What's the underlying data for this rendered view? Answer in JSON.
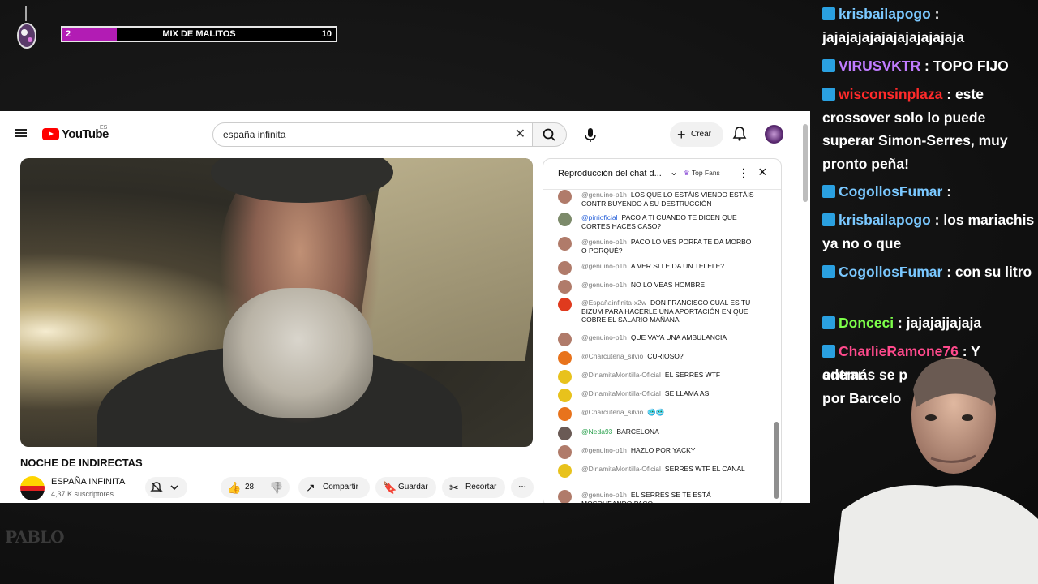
{
  "overlay": {
    "goal_current": "2",
    "goal_title": "MIX DE MALITOS",
    "goal_target": "10",
    "goal_fraction": 0.2
  },
  "youtube": {
    "logo_text": "YouTube",
    "country_code": "ES",
    "search_value": "españa infinita",
    "create_label": "Crear",
    "video_title": "NOCHE DE INDIRECTAS",
    "channel_name": "ESPAÑA INFINITA",
    "channel_subs": "4,37 K suscriptores",
    "like_count": "28",
    "share_label": "Compartir",
    "save_label": "Guardar",
    "clip_label": "Recortar"
  },
  "live_chat": {
    "title": "Reproducción del chat d...",
    "badge": "Top Fans",
    "messages": [
      {
        "author": "@genuino-p1h",
        "text": "LOS QUE LO ESTÁIS VIENDO ESTÁIS CONTRIBUYENDO A SU DESTRUCCIÓN",
        "avatar": "#b07b6a",
        "style": ""
      },
      {
        "author": "@pirrioficial",
        "text": "PACO A TI CUANDO TE DICEN QUE CORTES HACES CASO?",
        "avatar": "#7c8a6a",
        "style": "blue"
      },
      {
        "author": "@genuino-p1h",
        "text": "PACO LO VES PORFA TE DA MORBO O PORQUÉ?",
        "avatar": "#b07b6a",
        "style": ""
      },
      {
        "author": "@genuino-p1h",
        "text": "A VER SI LE DA UN TELELE?",
        "avatar": "#b07b6a",
        "style": ""
      },
      {
        "author": "@genuino-p1h",
        "text": "NO LO VEAS HOMBRE",
        "avatar": "#b07b6a",
        "style": ""
      },
      {
        "author": "@Españainfinita-x2w",
        "text": "DON FRANCISCO CUAL ES TU BIZUM PARA HACERLE UNA APORTACIÓN EN QUE COBRE EL SALARIO MAÑANA",
        "avatar": "#e03a1e",
        "style": ""
      },
      {
        "author": "@genuino-p1h",
        "text": "QUE VAYA UNA AMBULANCIA",
        "avatar": "#b07b6a",
        "style": ""
      },
      {
        "author": "@Charcuteria_silvio",
        "text": "CURIOSO?",
        "avatar": "#e8731c",
        "style": ""
      },
      {
        "author": "@DinamitaMontilla-Oficial",
        "text": "EL SERRES WTF",
        "avatar": "#e8c21c",
        "style": ""
      },
      {
        "author": "@DinamitaMontilla-Oficial",
        "text": "SE LLAMA ASI",
        "avatar": "#e8c21c",
        "style": ""
      },
      {
        "author": "@Charcuteria_silvio",
        "text": "🥶🥶",
        "avatar": "#e8731c",
        "style": ""
      },
      {
        "author": "@Neda93",
        "text": "BARCELONA",
        "avatar": "#6a5a55",
        "style": "green"
      },
      {
        "author": "@genuino-p1h",
        "text": "HAZLO POR YACKY",
        "avatar": "#b07b6a",
        "style": ""
      },
      {
        "author": "@DinamitaMontilla-Oficial",
        "text": "SERRES WTF EL CANAL",
        "avatar": "#e8c21c",
        "style": ""
      },
      {
        "author": "@genuino-p1h",
        "text": "EL SERRES SE TE ESTÁ MOSQUEANDO PACO",
        "avatar": "#b07b6a",
        "style": ""
      }
    ]
  },
  "stream_chat": [
    {
      "user": "krisbailapogo",
      "sep": " : ",
      "text": "jajajajajajajajajajajaja",
      "color": "#7ac8ff"
    },
    {
      "user": "VIRUSVKTR",
      "sep": " : ",
      "text": "TOPO FIJO",
      "color": "#c07cff"
    },
    {
      "user": "wisconsinplaza",
      "sep": " : ",
      "text": "este crossover solo lo puede superar Simon-Serres, muy pronto peña!",
      "color": "#ff2a2a"
    },
    {
      "user": "CogollosFumar",
      "sep": " : ",
      "text": "",
      "color": "#7ac8ff"
    },
    {
      "user": "krisbailapogo",
      "sep": " : ",
      "text": "los mariachis ya no o que",
      "color": "#7ac8ff"
    },
    {
      "user": "CogollosFumar",
      "sep": " : ",
      "text": "con su litro",
      "color": "#7ac8ff"
    },
    {
      "user": "Donceci",
      "sep": " : ",
      "text": "jajajajjajaja",
      "color": "#7dff4a"
    },
    {
      "user": "CharlieRamone76",
      "sep": " : ",
      "text": "Y además se p",
      "color": "#ff4a8c"
    },
    {
      "user": "",
      "sep": "",
      "text": "ontrar",
      "color": "#ffffff"
    },
    {
      "user": "",
      "sep": "",
      "text": "por Barcelo",
      "color": "#ffffff"
    }
  ],
  "branding": {
    "watermark_text": "PABLO"
  }
}
